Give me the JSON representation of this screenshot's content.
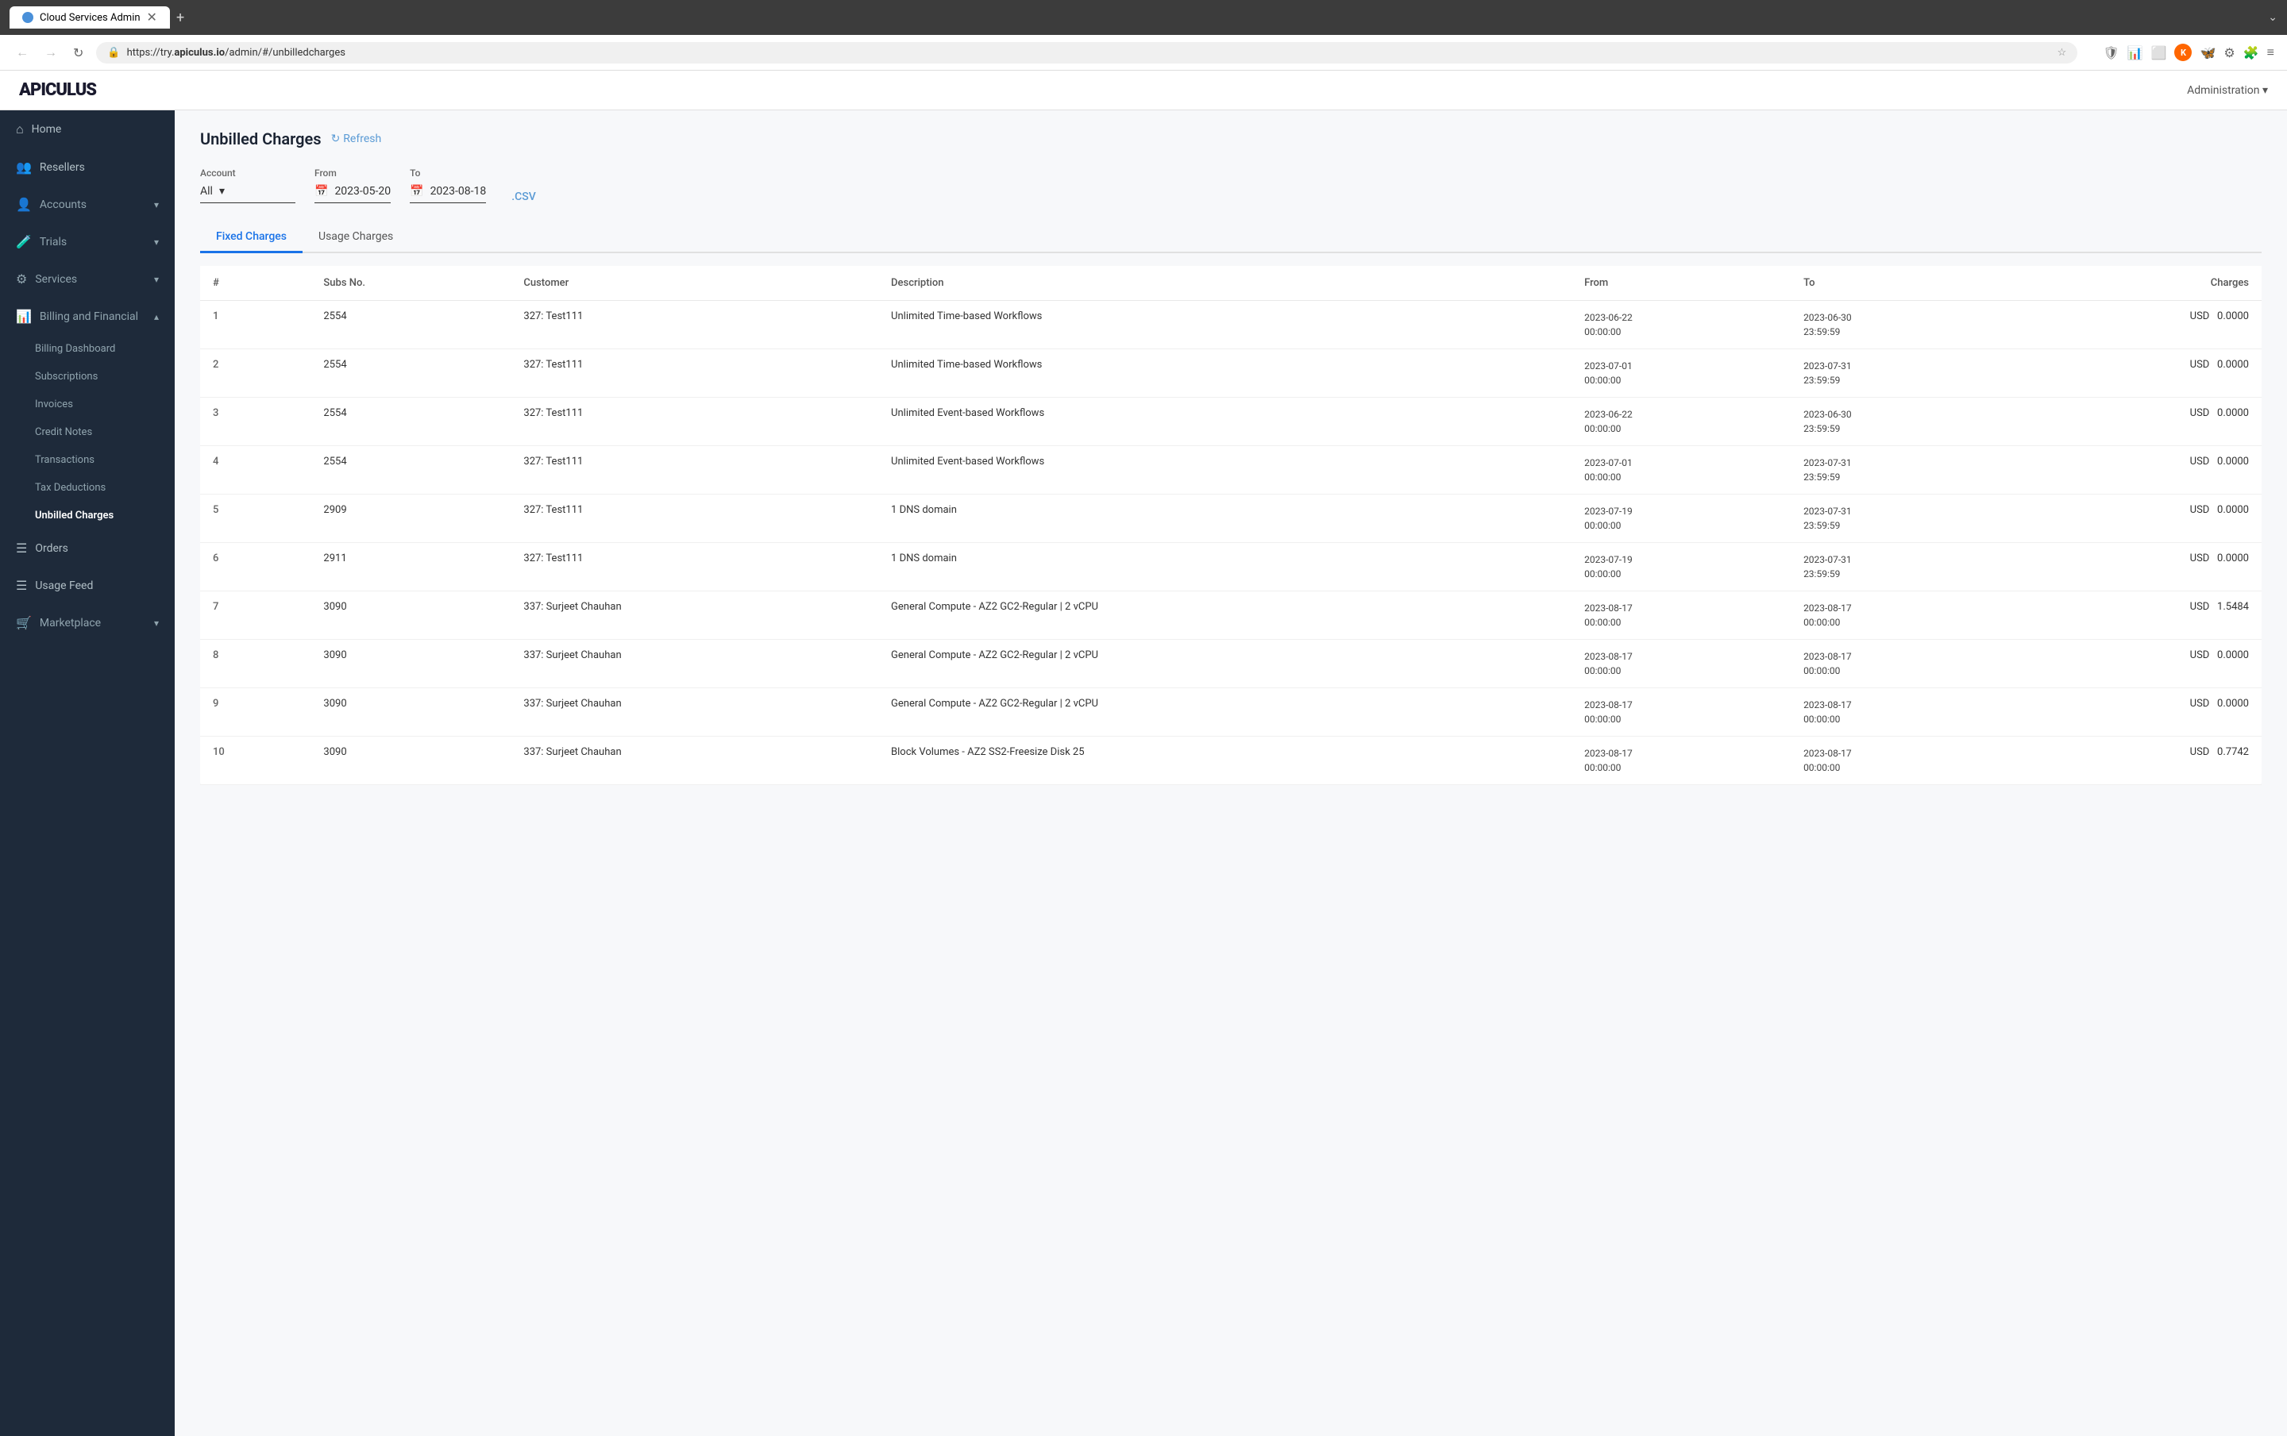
{
  "browser": {
    "tab_title": "Cloud Services Admin",
    "tab_favicon_color": "#4a90d9",
    "url": "https://try.apiculus.io/admin/#/unbilledcharges",
    "url_domain": "apiculus.io"
  },
  "app": {
    "logo": "APICULUS",
    "admin_label": "Administration ▾"
  },
  "sidebar": {
    "items": [
      {
        "id": "home",
        "icon": "⌂",
        "label": "Home",
        "active": false
      },
      {
        "id": "resellers",
        "icon": "👥",
        "label": "Resellers",
        "active": false
      },
      {
        "id": "accounts",
        "icon": "👤",
        "label": "Accounts",
        "active": false,
        "has_arrow": true
      },
      {
        "id": "trials",
        "icon": "🧪",
        "label": "Trials",
        "active": false,
        "has_arrow": true
      },
      {
        "id": "services",
        "icon": "⚙",
        "label": "Services",
        "active": false,
        "has_arrow": true
      },
      {
        "id": "billing-financial",
        "icon": "📊",
        "label": "Billing and Financial",
        "active": false,
        "has_arrow": true,
        "expanded": true
      },
      {
        "id": "billing-dashboard",
        "icon": "📋",
        "label": "Billing Dashboard",
        "active": false,
        "sub": true
      },
      {
        "id": "subscriptions",
        "icon": "☰",
        "label": "Subscriptions",
        "active": false,
        "sub": true
      },
      {
        "id": "invoices",
        "icon": "📄",
        "label": "Invoices",
        "active": false,
        "sub": true
      },
      {
        "id": "credit-notes",
        "icon": "📝",
        "label": "Credit Notes",
        "active": false,
        "sub": true
      },
      {
        "id": "transactions",
        "icon": "↔",
        "label": "Transactions",
        "active": false,
        "sub": true
      },
      {
        "id": "tax-deductions",
        "icon": "◎",
        "label": "Tax Deductions",
        "active": false,
        "sub": true
      },
      {
        "id": "unbilled-charges",
        "icon": "☰",
        "label": "Unbilled Charges",
        "active": true,
        "sub": true
      },
      {
        "id": "orders",
        "icon": "☰",
        "label": "Orders",
        "active": false
      },
      {
        "id": "usage-feed",
        "icon": "☰",
        "label": "Usage Feed",
        "active": false
      },
      {
        "id": "marketplace",
        "icon": "🛒",
        "label": "Marketplace",
        "active": false,
        "has_arrow": true
      }
    ]
  },
  "page": {
    "title": "Unbilled Charges",
    "refresh_label": "Refresh"
  },
  "filters": {
    "account_label": "Account",
    "account_value": "All",
    "from_label": "From",
    "from_value": "2023-05-20",
    "to_label": "To",
    "to_value": "2023-08-18",
    "csv_label": ".CSV"
  },
  "tabs": [
    {
      "id": "fixed",
      "label": "Fixed Charges",
      "active": true
    },
    {
      "id": "usage",
      "label": "Usage Charges",
      "active": false
    }
  ],
  "table": {
    "columns": [
      "#",
      "Subs No.",
      "Customer",
      "Description",
      "From",
      "To",
      "Charges"
    ],
    "rows": [
      {
        "num": 1,
        "subs": "2554",
        "customer": "327: Test111",
        "description": "Unlimited Time-based Workflows",
        "from": "2023-06-22\n00:00:00",
        "to": "2023-06-30\n23:59:59",
        "currency": "USD",
        "amount": "0.0000"
      },
      {
        "num": 2,
        "subs": "2554",
        "customer": "327: Test111",
        "description": "Unlimited Time-based Workflows",
        "from": "2023-07-01\n00:00:00",
        "to": "2023-07-31\n23:59:59",
        "currency": "USD",
        "amount": "0.0000"
      },
      {
        "num": 3,
        "subs": "2554",
        "customer": "327: Test111",
        "description": "Unlimited Event-based Workflows",
        "from": "2023-06-22\n00:00:00",
        "to": "2023-06-30\n23:59:59",
        "currency": "USD",
        "amount": "0.0000"
      },
      {
        "num": 4,
        "subs": "2554",
        "customer": "327: Test111",
        "description": "Unlimited Event-based Workflows",
        "from": "2023-07-01\n00:00:00",
        "to": "2023-07-31\n23:59:59",
        "currency": "USD",
        "amount": "0.0000"
      },
      {
        "num": 5,
        "subs": "2909",
        "customer": "327: Test111",
        "description": "1 DNS domain",
        "from": "2023-07-19\n00:00:00",
        "to": "2023-07-31\n23:59:59",
        "currency": "USD",
        "amount": "0.0000"
      },
      {
        "num": 6,
        "subs": "2911",
        "customer": "327: Test111",
        "description": "1 DNS domain",
        "from": "2023-07-19\n00:00:00",
        "to": "2023-07-31\n23:59:59",
        "currency": "USD",
        "amount": "0.0000"
      },
      {
        "num": 7,
        "subs": "3090",
        "customer": "337: Surjeet Chauhan",
        "description": "General Compute - AZ2 GC2-Regular | 2 vCPU",
        "from": "2023-08-17\n00:00:00",
        "to": "2023-08-17\n00:00:00",
        "currency": "USD",
        "amount": "1.5484"
      },
      {
        "num": 8,
        "subs": "3090",
        "customer": "337: Surjeet Chauhan",
        "description": "General Compute - AZ2 GC2-Regular | 2 vCPU",
        "from": "2023-08-17\n00:00:00",
        "to": "2023-08-17\n00:00:00",
        "currency": "USD",
        "amount": "0.0000"
      },
      {
        "num": 9,
        "subs": "3090",
        "customer": "337: Surjeet Chauhan",
        "description": "General Compute - AZ2 GC2-Regular | 2 vCPU",
        "from": "2023-08-17\n00:00:00",
        "to": "2023-08-17\n00:00:00",
        "currency": "USD",
        "amount": "0.0000"
      },
      {
        "num": 10,
        "subs": "3090",
        "customer": "337: Surjeet Chauhan",
        "description": "Block Volumes - AZ2 SS2-Freesize Disk 25",
        "from": "2023-08-17\n00:00:00",
        "to": "2023-08-17\n00:00:00",
        "currency": "USD",
        "amount": "0.7742"
      }
    ]
  }
}
